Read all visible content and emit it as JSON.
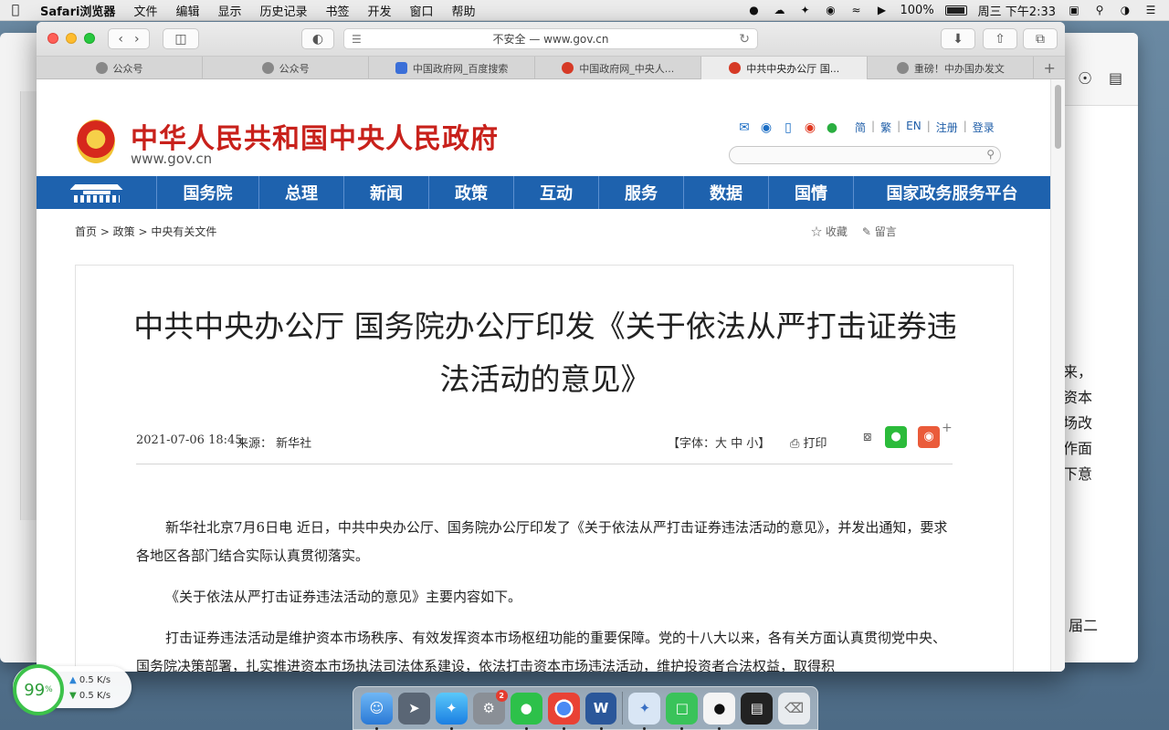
{
  "menubar": {
    "apple_icon": "apple-icon",
    "app_name": "Safari浏览器",
    "menus": [
      "文件",
      "编辑",
      "显示",
      "历史记录",
      "书签",
      "开发",
      "窗口",
      "帮助"
    ],
    "battery": "100%",
    "clock": "周三 下午2:33"
  },
  "safari": {
    "address": "不安全 — www.gov.cn",
    "tabs": [
      {
        "label": "公众号",
        "icon": "wechat-icon"
      },
      {
        "label": "公众号",
        "icon": "wechat-icon"
      },
      {
        "label": "中国政府网_百度搜索",
        "icon": "baidu-icon"
      },
      {
        "label": "中国政府网_中央人...",
        "icon": "gov-emblem-icon"
      },
      {
        "label": "中共中央办公厅 国...",
        "icon": "gov-emblem-icon"
      },
      {
        "label": "重磅！中办国办发文",
        "icon": "wechat-icon"
      }
    ]
  },
  "site": {
    "title": "中华人民共和国中央人民政府",
    "url": "www.gov.cn",
    "header_links": [
      "简",
      "繁",
      "EN",
      "注册",
      "登录"
    ],
    "nav": [
      "国务院",
      "总理",
      "新闻",
      "政策",
      "互动",
      "服务",
      "数据",
      "国情",
      "国家政务服务平台"
    ]
  },
  "breadcrumb": "首页 > 政策 > 中央有关文件",
  "actions": {
    "favorite": "收藏",
    "comment": "留言"
  },
  "article": {
    "title": "中共中央办公厅 国务院办公厅印发《关于依法从严打击证券违法活动的意见》",
    "date": "2021-07-06 18:45",
    "source_label": "来源：",
    "source": "新华社",
    "font_size": "【字体：大 中 小】",
    "print": "打印",
    "paragraphs": [
      "新华社北京7月6日电 近日，中共中央办公厅、国务院办公厅印发了《关于依法从严打击证券违法活动的意见》，并发出通知，要求各地区各部门结合实际认真贯彻落实。",
      "《关于依法从严打击证券违法活动的意见》主要内容如下。",
      "打击证券违法活动是维护资本市场秩序、有效发挥资本市场枢纽功能的重要保障。党的十八大以来，各有关方面认真贯彻党中央、国务院决策部署，扎实推进资本市场执法司法体系建设，依法打击资本市场违法活动，维护投资者合法权益，取得积"
    ]
  },
  "back_window": {
    "lines": [
      "来，",
      "资本",
      "场改",
      "作面",
      "下意"
    ],
    "bottom": "届二"
  },
  "speed": {
    "percent": "99",
    "up": "0.5 K/s",
    "down": "0.5 K/s"
  }
}
